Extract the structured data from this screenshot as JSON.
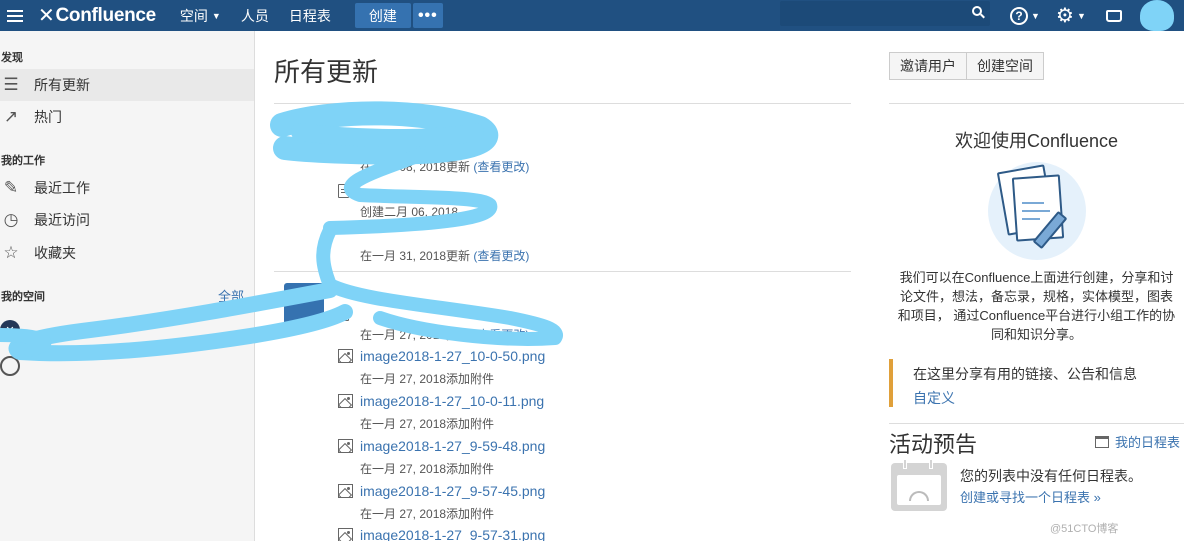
{
  "header": {
    "logo_text": "Confluence",
    "nav": [
      {
        "label": "空间",
        "has_caret": true
      },
      {
        "label": "人员"
      },
      {
        "label": "日程表"
      }
    ],
    "create_label": "创建",
    "more_label": "•••",
    "search_placeholder": "",
    "help_label": "?",
    "accent": "#205081"
  },
  "sidebar": {
    "discover_heading": "发现",
    "discover_items": [
      {
        "label": "所有更新",
        "icon": "list-icon",
        "active": true
      },
      {
        "label": "热门",
        "icon": "trending-icon"
      }
    ],
    "mywork_heading": "我的工作",
    "mywork_items": [
      {
        "label": "最近工作",
        "icon": "edit-icon"
      },
      {
        "label": "最近访问",
        "icon": "clock-icon"
      },
      {
        "label": "收藏夹",
        "icon": "star-icon"
      }
    ],
    "spaces_heading": "我的空间",
    "spaces_all": "全部"
  },
  "main": {
    "title": "所有更新",
    "group1": [
      {
        "type": "page",
        "meta": "在二月 08, 2018更新",
        "link": "(查看更改)"
      },
      {
        "type": "page",
        "meta": "创建二月 06, 2018",
        "link": ""
      },
      {
        "type": "page",
        "meta": "在一月 31, 2018更新",
        "link": "(查看更改)"
      }
    ],
    "group2_first": {
      "meta": "在一月 27, 2018更新",
      "link": "(查看更改)"
    },
    "attachments": [
      {
        "name": "image2018-1-27_10-0-50.png",
        "meta": "在一月 27, 2018添加附件"
      },
      {
        "name": "image2018-1-27_10-0-11.png",
        "meta": "在一月 27, 2018添加附件"
      },
      {
        "name": "image2018-1-27_9-59-48.png",
        "meta": "在一月 27, 2018添加附件"
      },
      {
        "name": "image2018-1-27_9-57-45.png",
        "meta": "在一月 27, 2018添加附件"
      },
      {
        "name": "image2018-1-27_9-57-31.png",
        "meta": ""
      }
    ]
  },
  "right": {
    "invite_label": "邀请用户",
    "create_space_label": "创建空间",
    "welcome_title": "欢迎使用Confluence",
    "welcome_lines": [
      "我们可以在Confluence上面进行创建，分享和讨",
      "论文件，想法，备忘录，规格，实体模型，图表",
      "和项目， 通过Confluence平台进行小组工作的协",
      "同和知识分享。"
    ],
    "share_text": "在这里分享有用的链接、公告和信息",
    "customize_label": "自定义",
    "events_title": "活动预告",
    "my_calendars": "我的日程表",
    "no_calendars": "您的列表中没有任何日程表。",
    "find_calendar": "创建或寻找一个日程表 »"
  },
  "watermark": "@51CTO博客",
  "colors": {
    "link": "#3b73af",
    "scribble": "#7fd3f7",
    "header": "#205081"
  }
}
